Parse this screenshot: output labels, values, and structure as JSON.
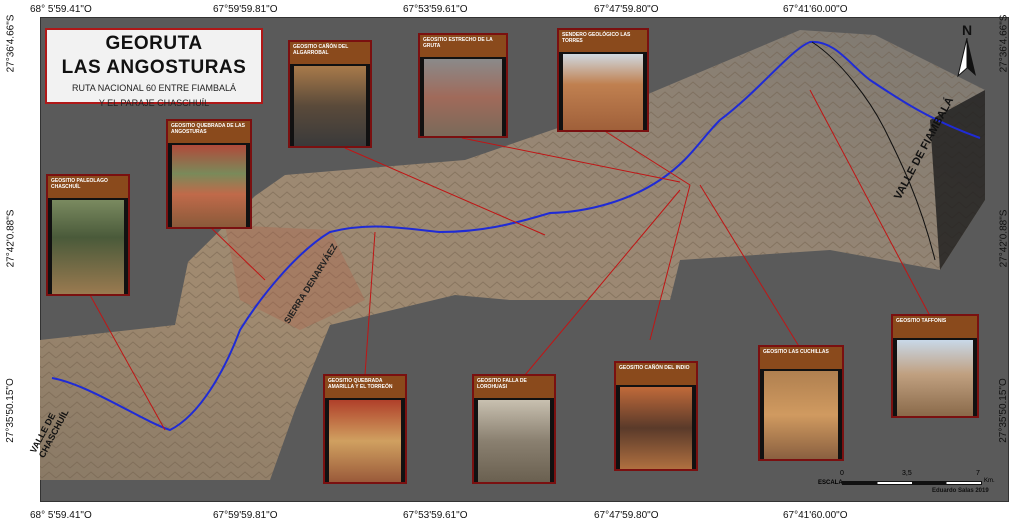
{
  "title": {
    "line1": "GEORUTA",
    "line2": "LAS ANGOSTURAS",
    "subtitle1": "RUTA NACIONAL 60 ENTRE FIAMBALÁ",
    "subtitle2": "Y EL PARAJE CHASCHUÍL"
  },
  "coords": {
    "top": [
      "68° 5'59.41\"O",
      "67°59'59.81\"O",
      "67°53'59.61\"O",
      "67°47'59.80\"O",
      "67°41'60.00\"O"
    ],
    "bottom": [
      "68° 5'59.41\"O",
      "67°59'59.81\"O",
      "67°53'59.61\"O",
      "67°47'59.80\"O",
      "67°41'60.00\"O"
    ],
    "left": [
      "27°36'4.66\"S",
      "27°42'0.88\"S",
      "27°35'50.15\"O"
    ],
    "right": [
      "27°36'4.66\"S",
      "27°42'0.88\"S",
      "27°35'50.15\"O"
    ]
  },
  "labels": {
    "valle_fiambala": "VALLE DE FIAMBALÁ",
    "valle_chaschuil": "VALLE DE CHASCHUÍL",
    "sierra": "SIERRA DENARVÁEZ"
  },
  "cards": [
    {
      "id": "paleolago",
      "title": "GEOSITIO PALEOLAGO CHASCHUÍL"
    },
    {
      "id": "quebrada_angosturas",
      "title": "GEOSITIO QUEBRADA DE LAS ANGOSTURAS"
    },
    {
      "id": "algarrobal",
      "title": "GEOSITIO CAÑÓN DEL ALGARROBAL"
    },
    {
      "id": "gruta",
      "title": "GEOSITIO ESTRECHO DE LA GRUTA"
    },
    {
      "id": "torres",
      "title": "SENDERO GEOLÓGICO LAS TORRES"
    },
    {
      "id": "amarilla",
      "title": "GEOSITIO QUEBRADA AMARILLA Y EL TORREÓN"
    },
    {
      "id": "falla",
      "title": "GEOSITIO FALLA DE LOROHUASI"
    },
    {
      "id": "indio",
      "title": "GEOSITIO CAÑÓN DEL INDIO"
    },
    {
      "id": "cuchillas",
      "title": "GEOSITIO LAS CUCHILLAS"
    },
    {
      "id": "taffonis",
      "title": "GEOSITIO TAFFONIS"
    }
  ],
  "north": "N",
  "scale": {
    "label": "ESCALA",
    "ticks": [
      "0",
      "3,5",
      "7"
    ],
    "unit": "Km."
  },
  "credit": "Eduardo Salas 2019",
  "colors": {
    "route": "#1f2bd6",
    "card_border": "#7a1010",
    "connector": "#c01515"
  }
}
